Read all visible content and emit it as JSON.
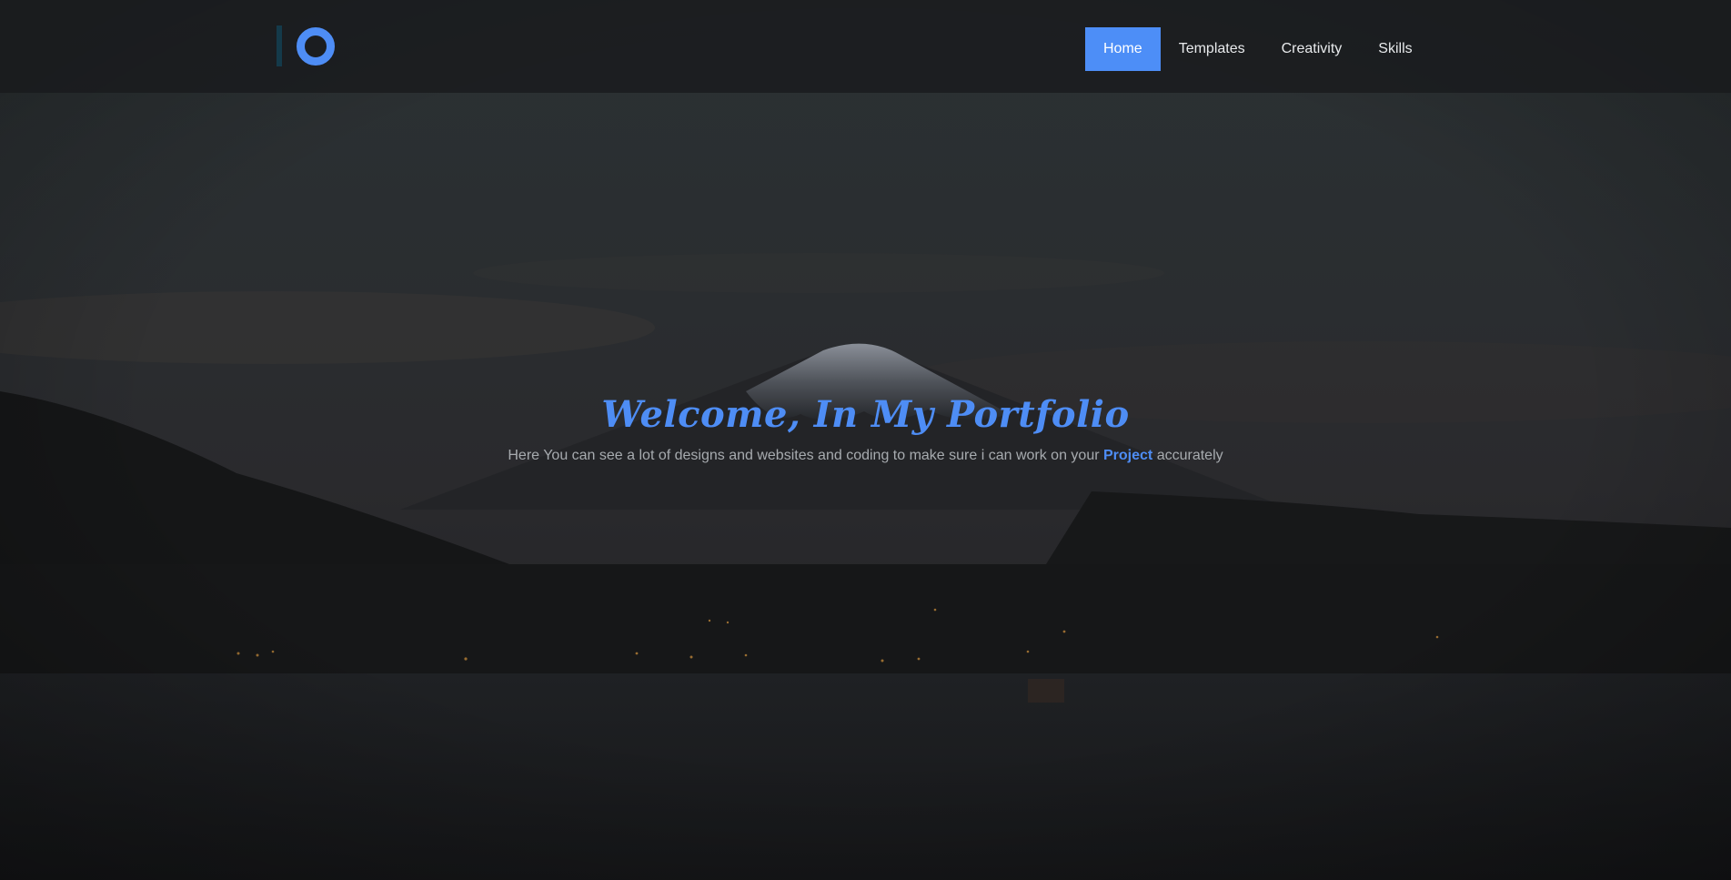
{
  "nav": {
    "items": [
      {
        "label": "Home",
        "active": true
      },
      {
        "label": "Templates",
        "active": false
      },
      {
        "label": "Creativity",
        "active": false
      },
      {
        "label": "Skills",
        "active": false
      }
    ]
  },
  "hero": {
    "title": "Welcome, In My Portfolio",
    "subtitle_before": "Here You can see a lot of designs and websites and coding to make sure i can work on your ",
    "subtitle_highlight": "Project",
    "subtitle_after": " accurately"
  },
  "logo": {
    "icon": "ring-logo-icon"
  },
  "background": {
    "scene": "mountain-at-night"
  },
  "colors": {
    "accent": "#4e8df5",
    "active_nav_bg": "#4d8ef7",
    "header_bg": "#1a1c1e",
    "subtitle_text": "#a7abaf",
    "nav_text": "#e8eaec"
  }
}
